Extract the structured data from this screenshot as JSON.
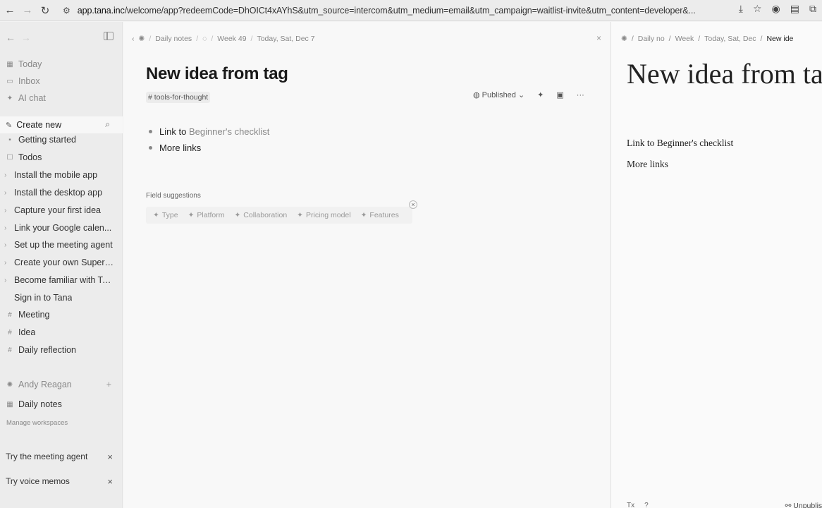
{
  "browser": {
    "url_host": "app.tana.inc",
    "url_rest": "/welcome/app?redeemCode=DhOICt4xAYhS&utm_source=intercom&utm_medium=email&utm_campaign=waitlist-invite&utm_content=developer&...",
    "back_icon": "arrow-left-icon",
    "forward_icon": "arrow-right-icon",
    "reload_icon": "reload-icon"
  },
  "sidebar": {
    "top_items": [
      {
        "label": "Today",
        "icon": "calendar-icon"
      },
      {
        "label": "Inbox",
        "icon": "inbox-icon"
      },
      {
        "label": "AI chat",
        "icon": "sparkle-icon"
      }
    ],
    "create_new": "Create new",
    "list": [
      {
        "label": "Getting started"
      },
      {
        "label": "Todos"
      },
      {
        "label": "Install the mobile app"
      },
      {
        "label": "Install the desktop app"
      },
      {
        "label": "Capture your first idea"
      },
      {
        "label": "Link your Google calen..."
      },
      {
        "label": "Set up the meeting agent"
      },
      {
        "label": "Create your own Supert..."
      },
      {
        "label": "Become familiar with Ta..."
      },
      {
        "label": "Sign in to Tana"
      },
      {
        "label": "Meeting"
      },
      {
        "label": "Idea"
      },
      {
        "label": "Daily reflection"
      }
    ],
    "workspace": "Andy Reagan",
    "daily_notes": "Daily notes",
    "manage": "Manage workspaces",
    "promos": [
      {
        "label": "Try the meeting agent"
      },
      {
        "label": "Try voice memos"
      }
    ]
  },
  "main": {
    "breadcrumb": [
      "Daily notes",
      "Week 49",
      "Today, Sat, Dec 7"
    ],
    "title": "New idea from tag",
    "tag": "# tools-for-thought",
    "published": "Published",
    "bullets": [
      {
        "prefix": "Link to",
        "link": "Beginner's checklist"
      },
      {
        "prefix": "More links",
        "link": ""
      }
    ],
    "field_suggestions_label": "Field suggestions",
    "suggestions": [
      "Type",
      "Platform",
      "Collaboration",
      "Pricing model",
      "Features"
    ]
  },
  "preview": {
    "breadcrumb": [
      "Daily no",
      "Week",
      "Today, Sat, Dec",
      "New ide"
    ],
    "title": "New idea from tag",
    "lines": [
      "Link to Beginner's checklist",
      "More links"
    ],
    "unpublish": "Unpublish"
  }
}
